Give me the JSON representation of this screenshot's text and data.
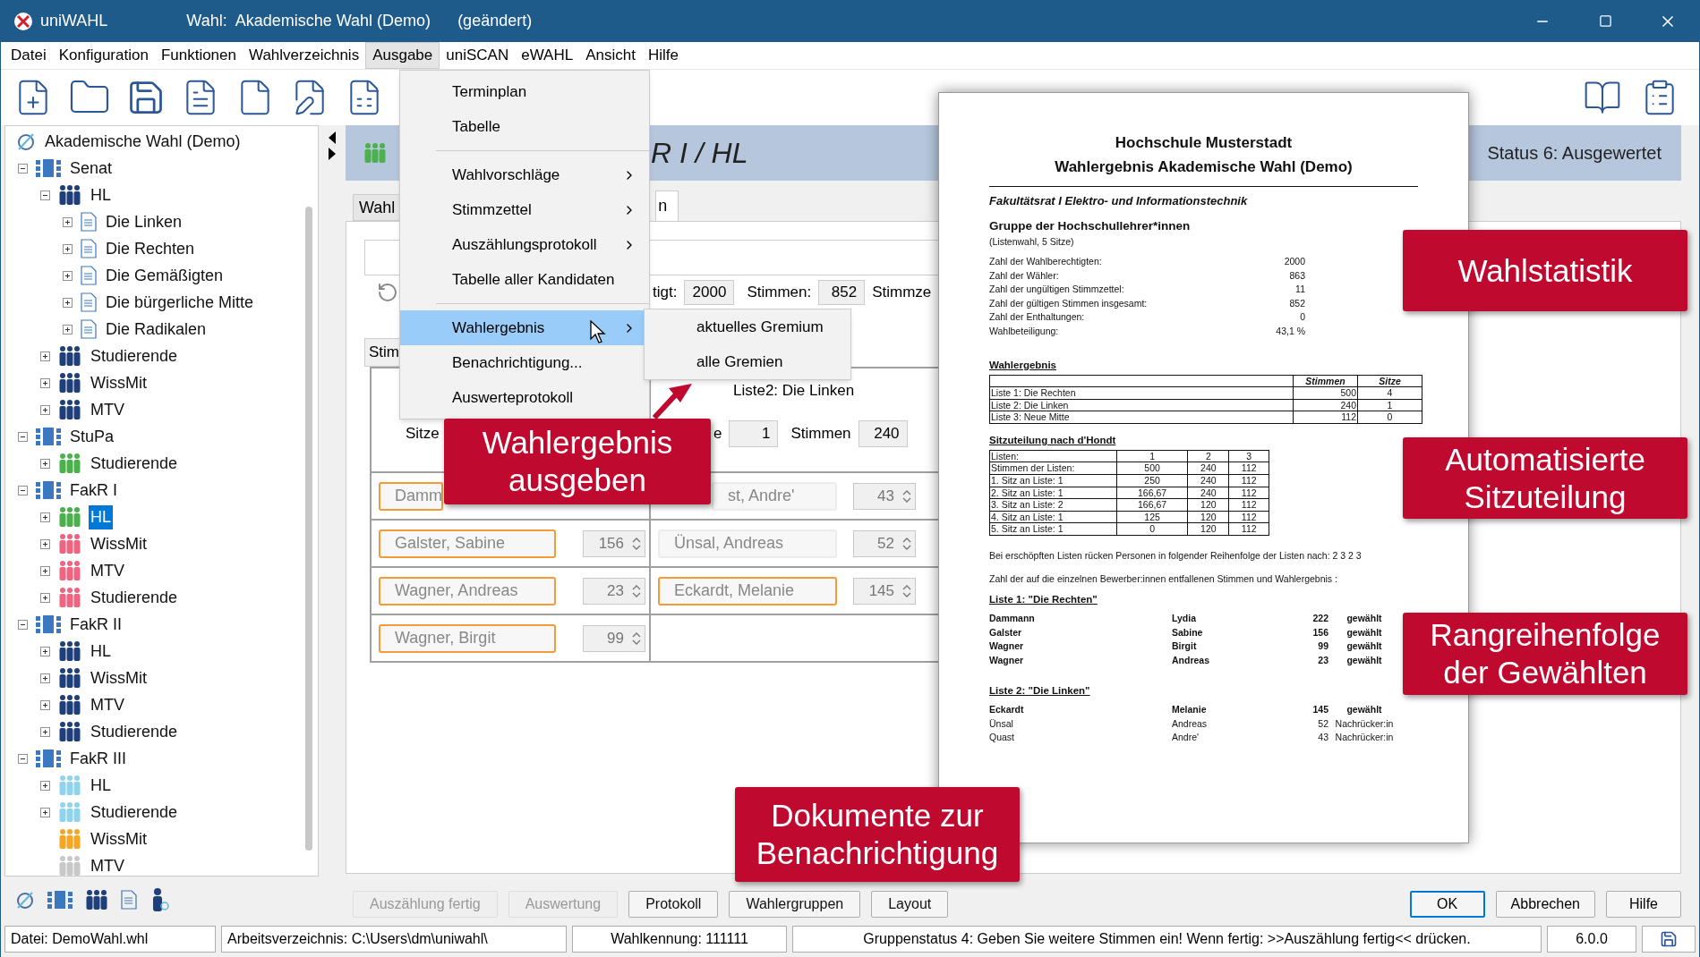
{
  "window": {
    "app": "uniWAHL",
    "title": "Wahl:  Akademische Wahl (Demo)",
    "modified": "(geändert)"
  },
  "menu": [
    {
      "label": "Datei",
      "selected": false
    },
    {
      "label": "Konfiguration",
      "selected": false
    },
    {
      "label": "Funktionen",
      "selected": false
    },
    {
      "label": "Wahlverzeichnis",
      "selected": false
    },
    {
      "label": "Ausgabe",
      "selected": true
    },
    {
      "label": "uniSCAN",
      "selected": false
    },
    {
      "label": "eWAHL",
      "selected": false
    },
    {
      "label": "Ansicht",
      "selected": false
    },
    {
      "label": "Hilfe",
      "selected": false
    }
  ],
  "dropdown": [
    {
      "kind": "item",
      "label": "Terminplan",
      "submenu": false,
      "selected": false
    },
    {
      "kind": "item",
      "label": "Tabelle",
      "submenu": false,
      "selected": false
    },
    {
      "kind": "separator"
    },
    {
      "kind": "item",
      "label": "Wahlvorschläge",
      "submenu": true,
      "selected": false
    },
    {
      "kind": "item",
      "label": "Stimmzettel",
      "submenu": true,
      "selected": false
    },
    {
      "kind": "item",
      "label": "Auszählungsprotokoll",
      "submenu": true,
      "selected": false
    },
    {
      "kind": "item",
      "label": "Tabelle aller Kandidaten",
      "submenu": false,
      "selected": false
    },
    {
      "kind": "separator"
    },
    {
      "kind": "item",
      "label": "Wahlergebnis",
      "submenu": true,
      "selected": true
    },
    {
      "kind": "item",
      "label": "Benachrichtigung...",
      "submenu": false,
      "selected": false
    },
    {
      "kind": "item",
      "label": "Auswerteprotokoll",
      "submenu": false,
      "selected": false
    }
  ],
  "submenu": [
    "aktuelles Gremium",
    "alle Gremien"
  ],
  "tree": {
    "label": "Akademische Wahl (Demo)",
    "kind": "root",
    "selected": false,
    "children": [
      {
        "label": "Senat",
        "kind": "body",
        "expanded": true,
        "selected": false,
        "children": [
          {
            "label": "HL",
            "kind": "group",
            "color": "#1f3f7a",
            "expanded": true,
            "selected": false,
            "children": [
              {
                "label": "Die Linken",
                "kind": "list",
                "expanded": false,
                "selected": false
              },
              {
                "label": "Die Rechten",
                "kind": "list",
                "expanded": false,
                "selected": false
              },
              {
                "label": "Die Gemäßigten",
                "kind": "list",
                "expanded": false,
                "selected": false
              },
              {
                "label": "Die bürgerliche Mitte",
                "kind": "list",
                "expanded": false,
                "selected": false
              },
              {
                "label": "Die Radikalen",
                "kind": "list",
                "expanded": false,
                "selected": false
              }
            ]
          },
          {
            "label": "Studierende",
            "kind": "group",
            "color": "#1f3f7a",
            "expanded": false,
            "selected": false
          },
          {
            "label": "WissMit",
            "kind": "group",
            "color": "#1f3f7a",
            "expanded": false,
            "selected": false
          },
          {
            "label": "MTV",
            "kind": "group",
            "color": "#1f3f7a",
            "expanded": false,
            "selected": false
          }
        ]
      },
      {
        "label": "StuPa",
        "kind": "body",
        "expanded": true,
        "selected": false,
        "children": [
          {
            "label": "Studierende",
            "kind": "group",
            "color": "#4cb04c",
            "expanded": false,
            "selected": false
          }
        ]
      },
      {
        "label": "FakR I",
        "kind": "body",
        "expanded": true,
        "selected": false,
        "children": [
          {
            "label": "HL",
            "kind": "group",
            "color": "#4cb04c",
            "expanded": false,
            "selected": true
          },
          {
            "label": "WissMit",
            "kind": "group",
            "color": "#f06482",
            "expanded": false,
            "selected": false
          },
          {
            "label": "MTV",
            "kind": "group",
            "color": "#f06482",
            "expanded": false,
            "selected": false
          },
          {
            "label": "Studierende",
            "kind": "group",
            "color": "#f06482",
            "expanded": false,
            "selected": false
          }
        ]
      },
      {
        "label": "FakR II",
        "kind": "body",
        "expanded": true,
        "selected": false,
        "children": [
          {
            "label": "HL",
            "kind": "group",
            "color": "#1f3f7a",
            "expanded": false,
            "selected": false
          },
          {
            "label": "WissMit",
            "kind": "group",
            "color": "#1f3f7a",
            "expanded": false,
            "selected": false
          },
          {
            "label": "MTV",
            "kind": "group",
            "color": "#1f3f7a",
            "expanded": false,
            "selected": false
          },
          {
            "label": "Studierende",
            "kind": "group",
            "color": "#1f3f7a",
            "expanded": false,
            "selected": false
          }
        ]
      },
      {
        "label": "FakR III",
        "kind": "body",
        "expanded": true,
        "selected": false,
        "children": [
          {
            "label": "HL",
            "kind": "group",
            "color": "#8fd3ec",
            "expanded": false,
            "selected": false
          },
          {
            "label": "Studierende",
            "kind": "group",
            "color": "#8fd3ec",
            "expanded": false,
            "selected": false
          },
          {
            "label": "WissMit",
            "kind": "group",
            "color": "#f5a623",
            "selected": false
          },
          {
            "label": "MTV",
            "kind": "group",
            "color": "#c8c8c8",
            "selected": false
          }
        ]
      }
    ]
  },
  "header": {
    "title": "R I / HL",
    "status": "Status 6: Ausgewertet"
  },
  "tabs": [
    {
      "label": "Wahl",
      "selected": false
    },
    {
      "label": "n",
      "selected": true
    }
  ],
  "counts": {
    "label_1": "tigt:",
    "value_1": "2000",
    "label_2": "Stimmen:",
    "value_2": "852",
    "label_3": "Stimmze"
  },
  "subtab": "Stim",
  "grid": {
    "left": {
      "seats_label": "Sitze",
      "candidates": [
        {
          "name": "Damm",
          "elected": true
        },
        {
          "name": "Galster, Sabine",
          "votes": "156",
          "elected": true
        },
        {
          "name": "Wagner, Andreas",
          "votes": "23",
          "elected": true
        },
        {
          "name": "Wagner, Birgit",
          "votes": "99",
          "elected": true
        }
      ]
    },
    "right": {
      "heading": "Liste2: Die Linken",
      "seats_label": "e",
      "seats": "1",
      "votes_label": "Stimmen",
      "votes": "240",
      "candidates": [
        {
          "name": "st, Andre'",
          "votes": "43",
          "elected": false
        },
        {
          "name": "Ünsal, Andreas",
          "votes": "52",
          "elected": false
        },
        {
          "name": "Eckardt, Melanie",
          "votes": "145",
          "elected": true
        }
      ]
    }
  },
  "buttons_left": [
    {
      "label": "Auszählung fertig",
      "disabled": true
    },
    {
      "label": "Auswertung",
      "disabled": true
    },
    {
      "label": "Protokoll",
      "disabled": false
    },
    {
      "label": "Wahlergruppen",
      "disabled": false
    },
    {
      "label": "Layout",
      "disabled": false
    }
  ],
  "buttons_right": [
    {
      "label": "OK",
      "default": true
    },
    {
      "label": "Abbrechen",
      "default": false
    },
    {
      "label": "Hilfe",
      "default": false
    }
  ],
  "status_bar": [
    "Datei: DemoWahl.whl",
    "Arbeitsverzeichnis: C:\\Users\\dm\\uniwahl\\",
    "Wahlkennung: 111111",
    "Gruppenstatus 4: Geben Sie weitere Stimmen ein! Wenn fertig: >>Auszählung fertig<< drücken.",
    "6.0.0"
  ],
  "document": {
    "heading": [
      "Hochschule Musterstadt",
      "Wahlergebnis Akademische Wahl (Demo)"
    ],
    "body": "Fakultätsrat I Elektro- und Informationstechnik",
    "group": "Gruppe der Hochschullehrer*innen",
    "mode": "(Listenwahl, 5 Sitze)",
    "stats": [
      {
        "label": "Zahl der Wahlberechtigten:",
        "value": "2000"
      },
      {
        "label": "Zahl der Wähler:",
        "value": "863"
      },
      {
        "label": "Zahl der ungültigen Stimmzettel:",
        "value": "11"
      },
      {
        "label": "Zahl der gültigen Stimmen insgesamt:",
        "value": "852"
      },
      {
        "label": "Zahl der Enthaltungen:",
        "value": "0"
      },
      {
        "label": "Wahlbeteiligung:",
        "value": "43,1 %"
      }
    ],
    "result": {
      "title": "Wahlergebnis",
      "columns": [
        "",
        "Stimmen",
        "Sitze"
      ],
      "rows": [
        [
          "Liste 1: Die Rechten",
          "500",
          "4"
        ],
        [
          "Liste 2: Die Linken",
          "240",
          "1"
        ],
        [
          "Liste 3: Neue Mitte",
          "112",
          "0"
        ]
      ]
    },
    "dhondt": {
      "title": "Sitzuteilung nach d'Hondt",
      "rows": [
        [
          "Listen:",
          "1",
          "2",
          "3"
        ],
        [
          "Stimmen der Listen:",
          "500",
          "240",
          "112"
        ],
        [
          "1. Sitz an Liste: 1",
          "250",
          "240",
          "112"
        ],
        [
          "2. Sitz an Liste: 1",
          "166,67",
          "240",
          "112"
        ],
        [
          "3. Sitz an Liste: 2",
          "166,67",
          "120",
          "112"
        ],
        [
          "4. Sitz an Liste: 1",
          "125",
          "120",
          "112"
        ],
        [
          "5. Sitz an Liste: 1",
          "0",
          "120",
          "112"
        ]
      ]
    },
    "notes": [
      "Bei erschöpften Listen rücken Personen in folgender Reihenfolge der Listen nach: 2 3 2 3",
      "Zahl der auf die einzelnen Bewerber:innen entfallenen Stimmen und Wahlergebnis :"
    ],
    "lists": [
      {
        "title": "Liste 1: \"Die Rechten\"",
        "candidates": [
          {
            "last": "Dammann",
            "first": "Lydia",
            "votes": "222",
            "status": "gewählt",
            "elected": true
          },
          {
            "last": "Galster",
            "first": "Sabine",
            "votes": "156",
            "status": "gewählt",
            "elected": true
          },
          {
            "last": "Wagner",
            "first": "Birgit",
            "votes": "99",
            "status": "gewählt",
            "elected": true
          },
          {
            "last": "Wagner",
            "first": "Andreas",
            "votes": "23",
            "status": "gewählt",
            "elected": true
          }
        ]
      },
      {
        "title": "Liste 2: \"Die Linken\"",
        "candidates": [
          {
            "last": "Eckardt",
            "first": "Melanie",
            "votes": "145",
            "status": "gewählt",
            "elected": true
          },
          {
            "last": "Ünsal",
            "first": "Andreas",
            "votes": "52",
            "status": "Nachrücker:in",
            "elected": false
          },
          {
            "last": "Quast",
            "first": "Andre'",
            "votes": "43",
            "status": "Nachrücker:in",
            "elected": false
          }
        ]
      }
    ]
  },
  "callouts": [
    "Wahlergebnis\nausgeben",
    "Wahlstatistik",
    "Automatisierte\nSitzuteilung",
    "Rangreihenfolge\nder Gewählten",
    "Dokumente zur\nBenachrichtigung"
  ]
}
